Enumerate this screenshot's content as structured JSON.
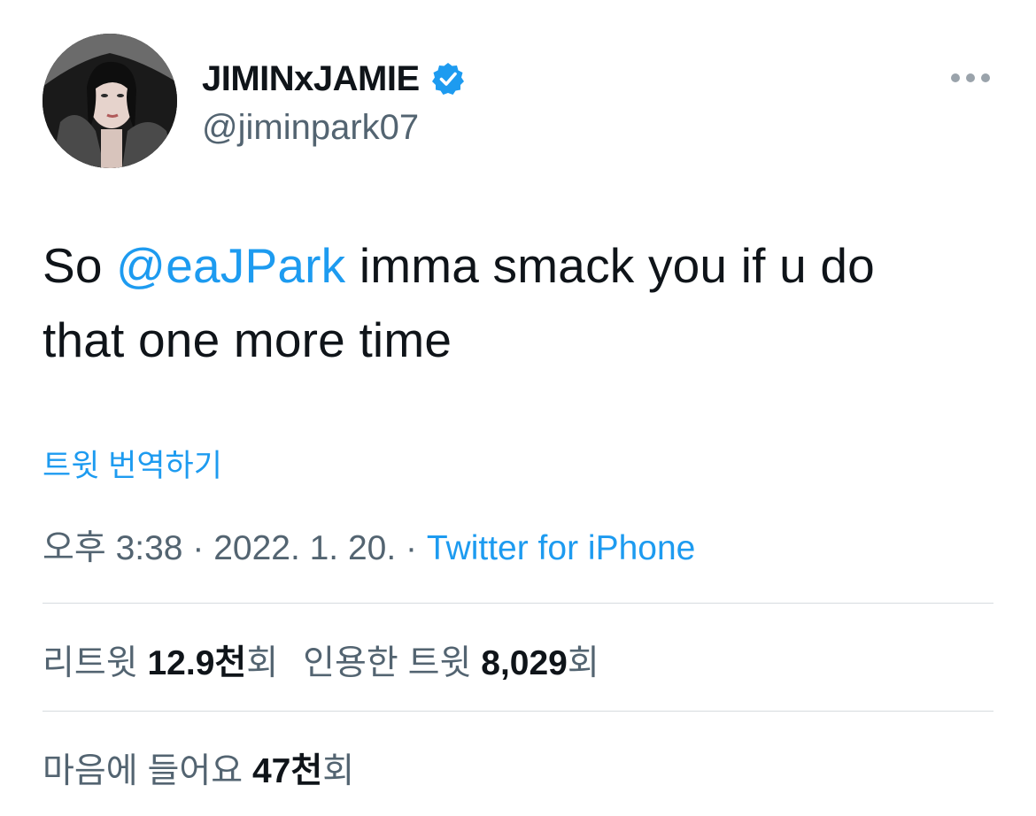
{
  "tweet": {
    "author": {
      "display_name": "JIMINxJAMIE",
      "handle": "@jiminpark07",
      "verified": true
    },
    "text": {
      "prefix": "So ",
      "mention": "@eaJPark",
      "line1_rest": " imma smack you if u do",
      "line2": "that one more time"
    },
    "translate_label": "트윗 번역하기",
    "meta": {
      "time": "오후 3:38",
      "sep1": " · ",
      "date": "2022. 1. 20.",
      "sep2": " · ",
      "source": "Twitter for iPhone"
    },
    "stats": {
      "retweets_label": "리트윗 ",
      "retweets_value": "12.9천",
      "retweets_suffix": "회",
      "quotes_label": "인용한 트윗 ",
      "quotes_value": "8,029",
      "quotes_suffix": "회",
      "likes_label": "마음에 들어요 ",
      "likes_value": "47천",
      "likes_suffix": "회"
    }
  },
  "colors": {
    "accent": "#1d9bf0",
    "text_primary": "#0f1419",
    "text_secondary": "#536471",
    "divider": "#d6dbdf"
  },
  "icons": {
    "verified": "verified-badge-icon",
    "more": "more-options-icon"
  }
}
